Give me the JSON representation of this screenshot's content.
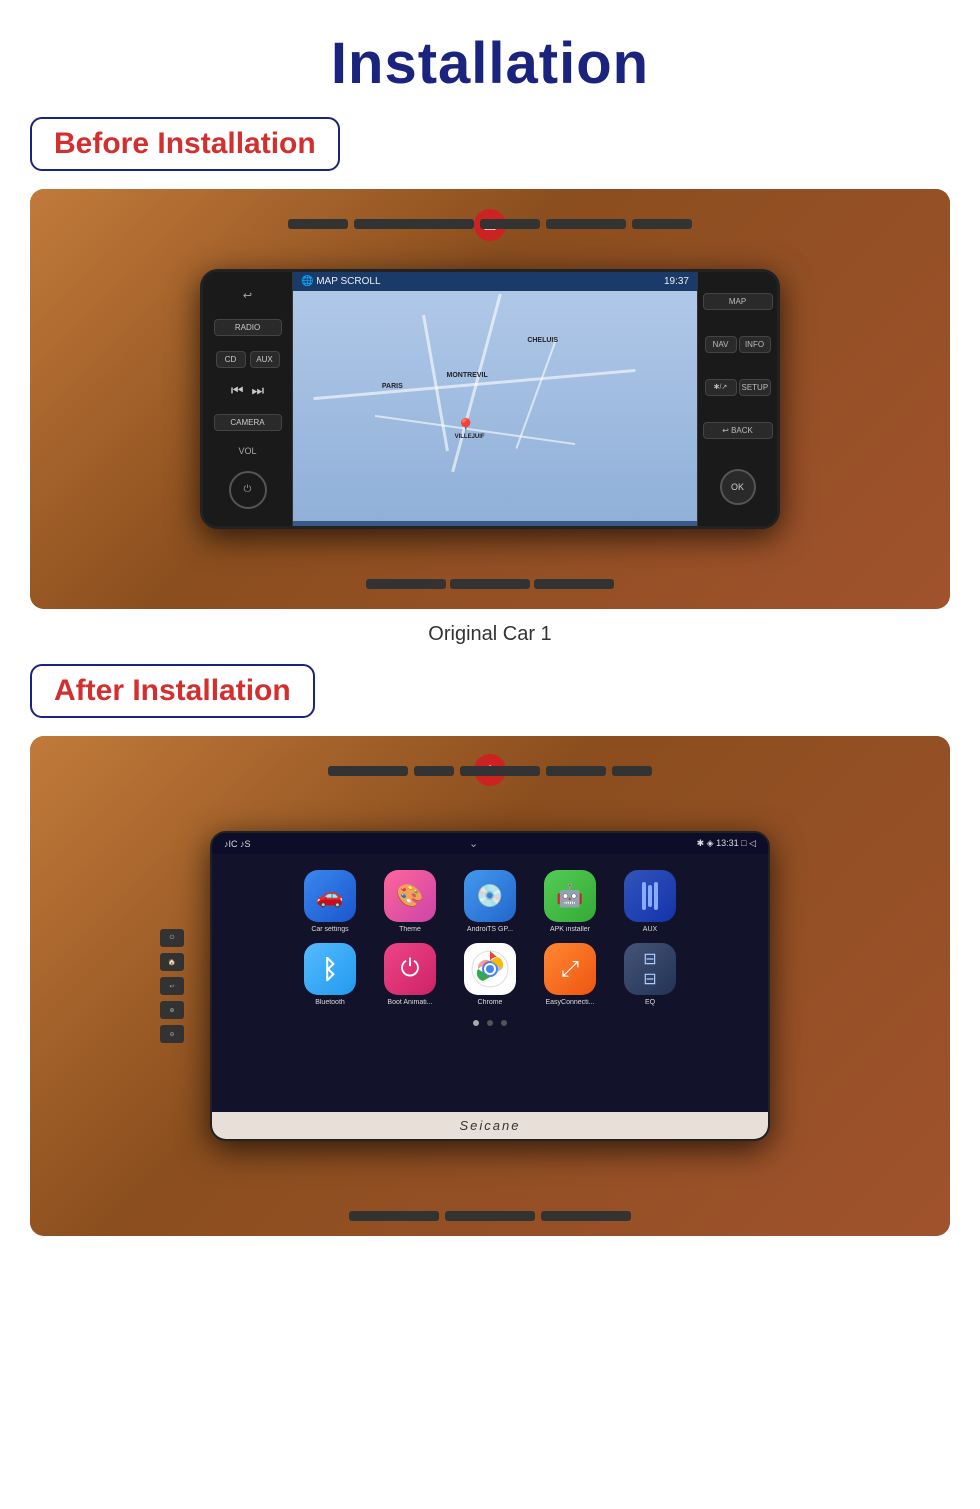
{
  "page": {
    "title": "Installation",
    "before_label": "Before Installation",
    "after_label": "After Installation",
    "caption": "Original Car  1",
    "seicane": "Seicane"
  },
  "nav_unit": {
    "header_left": "MAP SCROLL",
    "header_time": "19:37",
    "buttons_left": [
      "RADIO",
      "AUX",
      "CD",
      "CAMERA"
    ],
    "buttons_right": [
      "MAP",
      "NAV",
      "INFO",
      "SETUP",
      "BACK"
    ]
  },
  "android_unit": {
    "status_left": "♪IC  ♪S",
    "status_right": "* ◈ 13:31  □  ◁",
    "apps_row1": [
      {
        "label": "Car settings",
        "bg": "#2255cc",
        "icon": "🚗"
      },
      {
        "label": "Theme",
        "bg": "#cc44aa",
        "icon": "🎨"
      },
      {
        "label": "AndroiTS GP...",
        "bg": "#3399cc",
        "icon": "💿"
      },
      {
        "label": "APK installer",
        "bg": "#44aa44",
        "icon": "🤖"
      },
      {
        "label": "AUX",
        "bg": "#2244aa",
        "icon": "▐▐▐"
      }
    ],
    "apps_row2": [
      {
        "label": "Bluetooth",
        "bg": "#2299dd",
        "icon": "⟁"
      },
      {
        "label": "Boot Animati...",
        "bg": "#cc3366",
        "icon": "⏻"
      },
      {
        "label": "Chrome",
        "bg": "#ffffff",
        "icon": "◎"
      },
      {
        "label": "EasyConnecti...",
        "bg": "#ff6600",
        "icon": "⤢"
      },
      {
        "label": "EQ",
        "bg": "#334466",
        "icon": "≡"
      }
    ]
  }
}
